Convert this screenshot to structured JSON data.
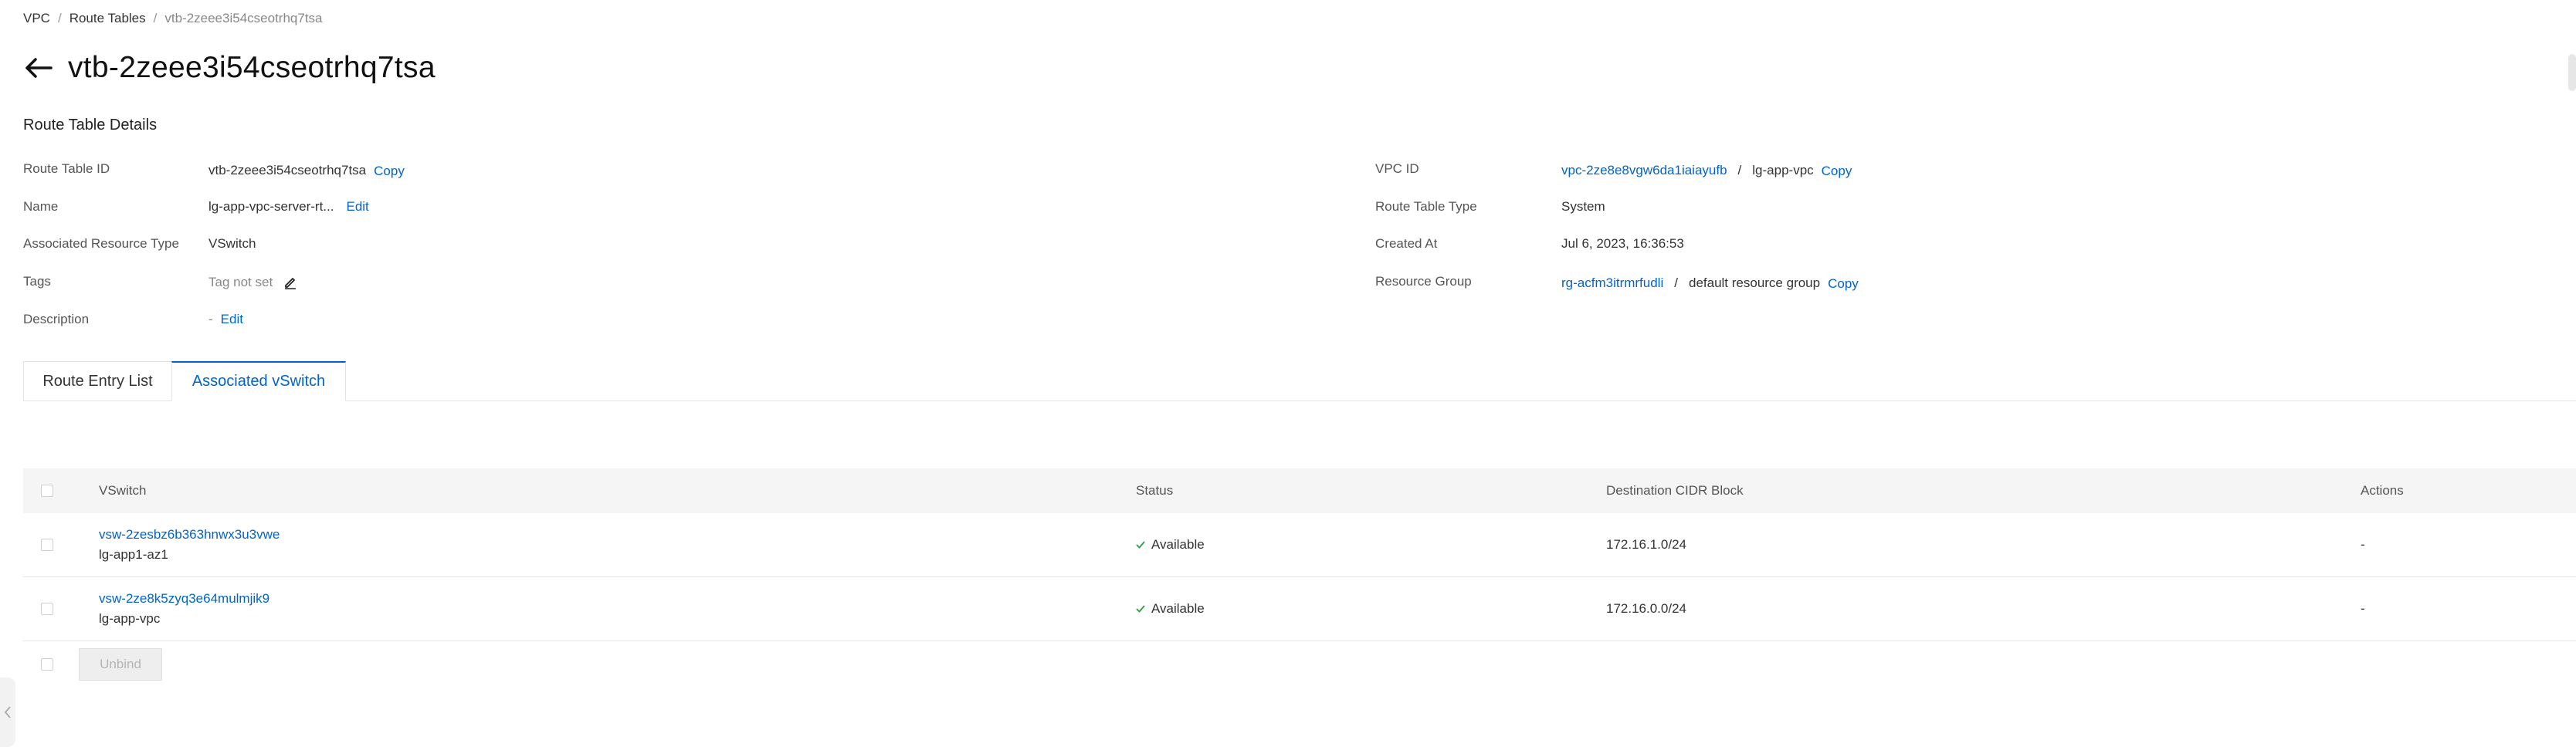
{
  "breadcrumb": {
    "items": [
      "VPC",
      "Route Tables",
      "vtb-2zeee3i54cseotrhq7tsa"
    ],
    "separator": "/"
  },
  "page": {
    "title": "vtb-2zeee3i54cseotrhq7tsa",
    "back_icon": "arrow-left-icon"
  },
  "details": {
    "section_title": "Route Table Details",
    "left": {
      "route_table_id": {
        "label": "Route Table ID",
        "value": "vtb-2zeee3i54cseotrhq7tsa",
        "action": "Copy"
      },
      "name": {
        "label": "Name",
        "value": "lg-app-vpc-server-rt...",
        "action": "Edit"
      },
      "associated_resource_type": {
        "label": "Associated Resource Type",
        "value": "VSwitch"
      },
      "tags": {
        "label": "Tags",
        "value": "Tag not set",
        "icon": "edit-pencil-icon"
      },
      "description": {
        "label": "Description",
        "value": "-",
        "action": "Edit"
      }
    },
    "right": {
      "vpc_id": {
        "label": "VPC ID",
        "link": "vpc-2ze8e8vgw6da1iaiayufb",
        "separator": "/",
        "value": "lg-app-vpc",
        "action": "Copy"
      },
      "route_table_type": {
        "label": "Route Table Type",
        "value": "System"
      },
      "created_at": {
        "label": "Created At",
        "value": "Jul 6, 2023, 16:36:53"
      },
      "resource_group": {
        "label": "Resource Group",
        "link": "rg-acfm3itrmrfudli",
        "separator": "/",
        "value": "default resource group",
        "action": "Copy"
      }
    }
  },
  "tabs": [
    {
      "label": "Route Entry List",
      "active": false
    },
    {
      "label": "Associated vSwitch",
      "active": true
    }
  ],
  "table": {
    "columns": [
      "VSwitch",
      "Status",
      "Destination CIDR Block",
      "Actions"
    ],
    "rows": [
      {
        "vswitch_id": "vsw-2zesbz6b363hnwx3u3vwe",
        "vswitch_name": "lg-app1-az1",
        "status": "Available",
        "cidr": "172.16.1.0/24",
        "actions": "-"
      },
      {
        "vswitch_id": "vsw-2ze8k5zyq3e64mulmjik9",
        "vswitch_name": "lg-app-vpc",
        "status": "Available",
        "cidr": "172.16.0.0/24",
        "actions": "-"
      }
    ]
  },
  "footer": {
    "unbind_label": "Unbind"
  },
  "colors": {
    "link": "#0064c8",
    "status_ok": "#2e9e47",
    "header_bg": "#f5f5f5"
  }
}
